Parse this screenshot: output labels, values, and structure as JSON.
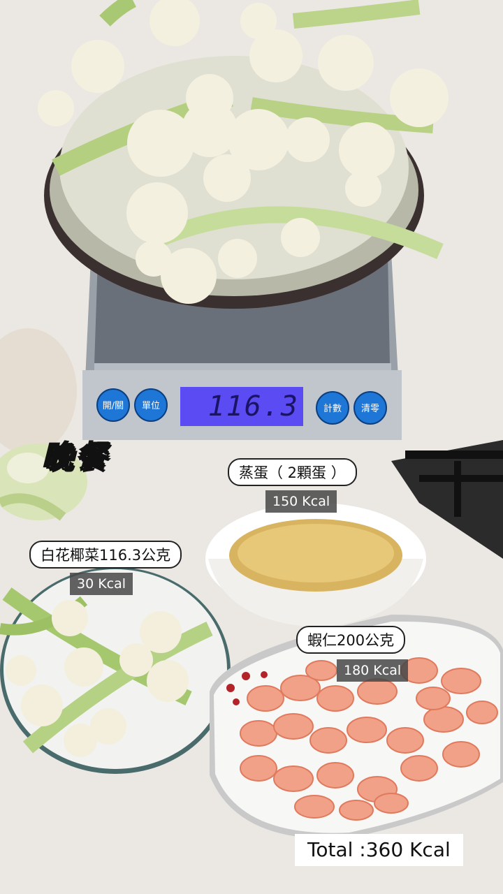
{
  "title": "晚餐",
  "scale": {
    "display": "116.3",
    "buttons": [
      "開/關",
      "單位",
      "計數",
      "清零"
    ]
  },
  "items": [
    {
      "name": "蒸蛋（ 2顆蛋 ）",
      "kcal": "150 Kcal"
    },
    {
      "name": "白花椰菜116.3公克",
      "kcal": "30 Kcal"
    },
    {
      "name": "蝦仁200公克",
      "kcal": "180 Kcal"
    }
  ],
  "total": "Total :360 Kcal",
  "colors": {
    "scale_lcd": "#5a4cf2",
    "scale_button": "#1e77d6",
    "kcal_tag": "#464646"
  }
}
